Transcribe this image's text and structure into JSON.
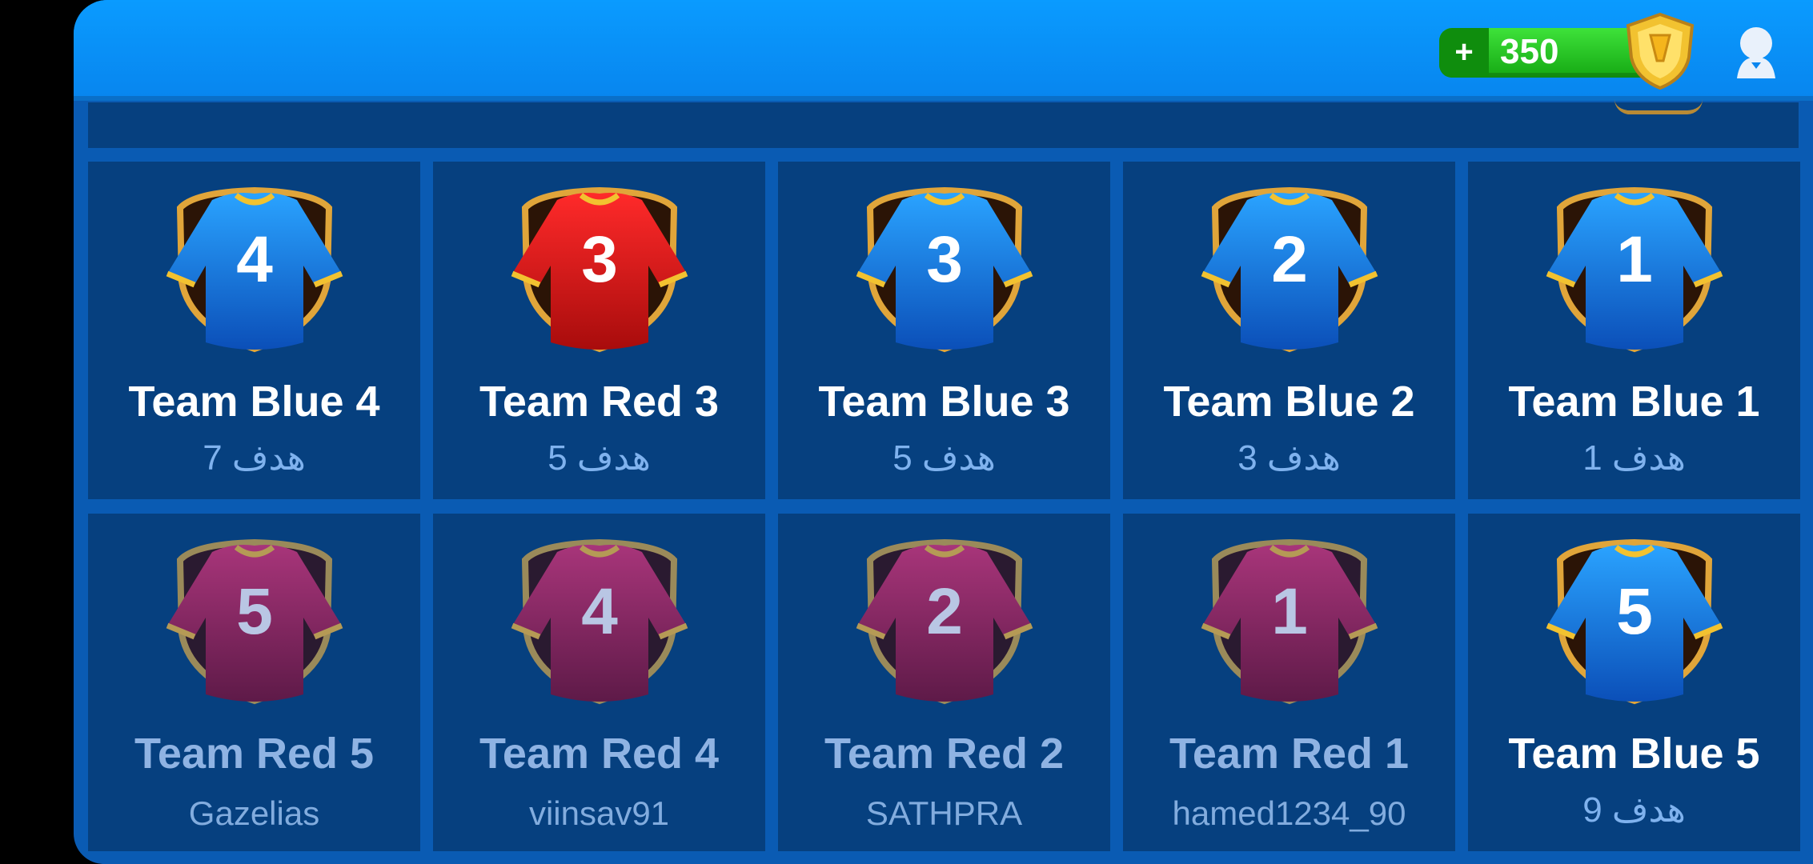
{
  "header": {
    "coins": "350",
    "plus_symbol": "+",
    "coin_icon": "gold-gem-shield-icon",
    "avatar_icon": "user-avatar-icon"
  },
  "colors": {
    "blue_shirt": "#1a7ee8",
    "red_shirt": "#e01a1a",
    "maroon_shirt": "#8e2a63",
    "gold_rim": "#e0a53a",
    "card_bg": "#06407f",
    "panel_bg": "#0a5bb3",
    "topbar_bg": "#0a9bff",
    "coin_green": "#2fcc2a"
  },
  "teams": [
    {
      "number": "4",
      "name": "Team Blue 4",
      "sub": "هدف 7",
      "color": "blue",
      "locked": false
    },
    {
      "number": "3",
      "name": "Team Red 3",
      "sub": "هدف 5",
      "color": "red",
      "locked": false
    },
    {
      "number": "3",
      "name": "Team Blue 3",
      "sub": "هدف 5",
      "color": "blue",
      "locked": false
    },
    {
      "number": "2",
      "name": "Team Blue 2",
      "sub": "هدف 3",
      "color": "blue",
      "locked": false
    },
    {
      "number": "1",
      "name": "Team Blue 1",
      "sub": "هدف 1",
      "color": "blue",
      "locked": false
    },
    {
      "number": "5",
      "name": "Team Red 5",
      "sub": "Gazelias",
      "color": "maroon",
      "locked": true
    },
    {
      "number": "4",
      "name": "Team Red 4",
      "sub": "viinsav91",
      "color": "maroon",
      "locked": true
    },
    {
      "number": "2",
      "name": "Team Red 2",
      "sub": "SATHPRA",
      "color": "maroon",
      "locked": true
    },
    {
      "number": "1",
      "name": "Team Red 1",
      "sub": "hamed1234_90",
      "color": "maroon",
      "locked": true
    },
    {
      "number": "5",
      "name": "Team Blue 5",
      "sub": "هدف 9",
      "color": "blue",
      "locked": false
    }
  ]
}
